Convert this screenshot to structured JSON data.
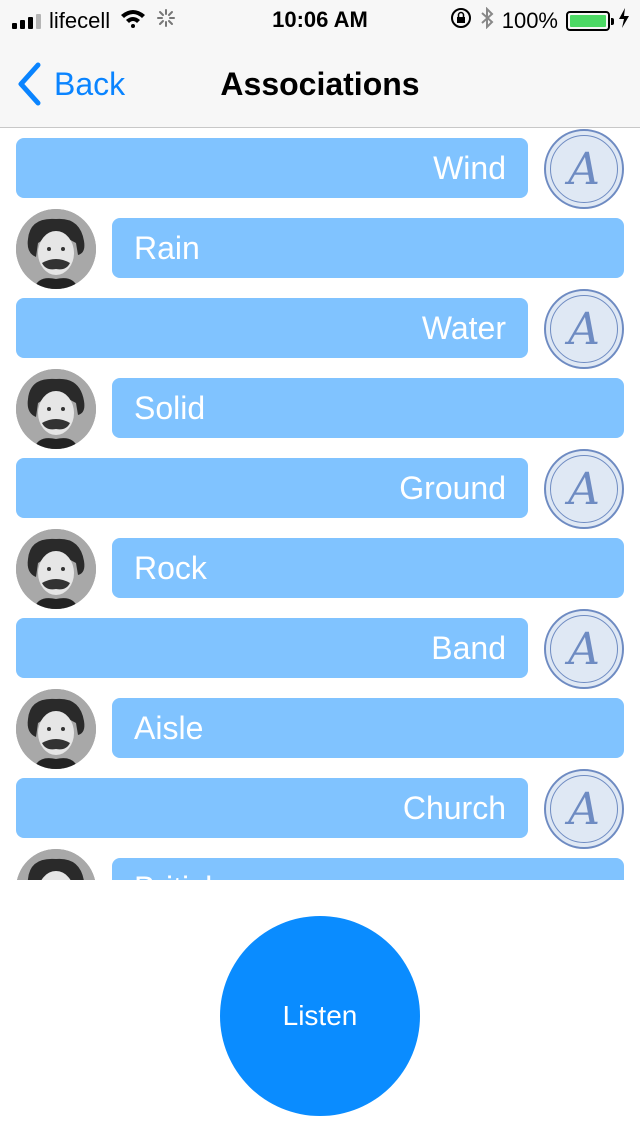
{
  "status_bar": {
    "carrier": "lifecell",
    "time": "10:06 AM",
    "battery": "100%"
  },
  "nav": {
    "back_label": "Back",
    "title": "Associations"
  },
  "messages": [
    {
      "side": "right",
      "text": "Wind",
      "badge_letter": "A"
    },
    {
      "side": "left",
      "text": "Rain"
    },
    {
      "side": "right",
      "text": "Water",
      "badge_letter": "A"
    },
    {
      "side": "left",
      "text": "Solid"
    },
    {
      "side": "right",
      "text": "Ground",
      "badge_letter": "A"
    },
    {
      "side": "left",
      "text": "Rock"
    },
    {
      "side": "right",
      "text": "Band",
      "badge_letter": "A"
    },
    {
      "side": "left",
      "text": "Aisle"
    },
    {
      "side": "right",
      "text": "Church",
      "badge_letter": "A"
    },
    {
      "side": "left",
      "text": "British"
    }
  ],
  "listen_button": {
    "label": "Listen",
    "color": "#0a8cff"
  },
  "colors": {
    "bubble": "#80c3ff",
    "accent": "#0a84ff",
    "badge_ring": "#6e8bc2"
  }
}
